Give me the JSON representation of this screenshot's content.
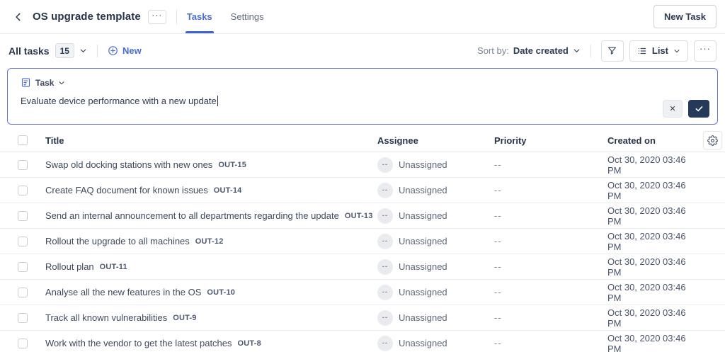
{
  "header": {
    "title": "OS upgrade template",
    "more_label": "···",
    "tabs": [
      {
        "label": "Tasks",
        "active": true
      },
      {
        "label": "Settings",
        "active": false
      }
    ],
    "new_task_button": "New Task"
  },
  "toolbar": {
    "view_label": "All tasks",
    "count_badge": "15",
    "new_label": "New",
    "sort_by_label": "Sort by:",
    "sort_value": "Date created",
    "list_button_label": "List",
    "more_label": "···"
  },
  "composer": {
    "type_label": "Task",
    "input_value": "Evaluate device performance with a new update",
    "cancel_label": "✕"
  },
  "table": {
    "columns": [
      "Title",
      "Assignee",
      "Priority",
      "Created on"
    ],
    "rows": [
      {
        "title": "Swap old docking stations with new ones",
        "id": "OUT-15",
        "avatar": "--",
        "assignee": "Unassigned",
        "priority": "--",
        "created": "Oct 30, 2020 03:46 PM"
      },
      {
        "title": "Create FAQ document for known issues",
        "id": "OUT-14",
        "avatar": "--",
        "assignee": "Unassigned",
        "priority": "--",
        "created": "Oct 30, 2020 03:46 PM"
      },
      {
        "title": "Send an internal announcement to all departments regarding the update",
        "id": "OUT-13",
        "avatar": "--",
        "assignee": "Unassigned",
        "priority": "--",
        "created": "Oct 30, 2020 03:46 PM"
      },
      {
        "title": "Rollout the upgrade to all machines",
        "id": "OUT-12",
        "avatar": "--",
        "assignee": "Unassigned",
        "priority": "--",
        "created": "Oct 30, 2020 03:46 PM"
      },
      {
        "title": "Rollout plan",
        "id": "OUT-11",
        "avatar": "--",
        "assignee": "Unassigned",
        "priority": "--",
        "created": "Oct 30, 2020 03:46 PM"
      },
      {
        "title": "Analyse all the new features in the OS",
        "id": "OUT-10",
        "avatar": "--",
        "assignee": "Unassigned",
        "priority": "--",
        "created": "Oct 30, 2020 03:46 PM"
      },
      {
        "title": "Track all known vulnerabilities",
        "id": "OUT-9",
        "avatar": "--",
        "assignee": "Unassigned",
        "priority": "--",
        "created": "Oct 30, 2020 03:46 PM"
      },
      {
        "title": "Work with the vendor to get the latest patches",
        "id": "OUT-8",
        "avatar": "--",
        "assignee": "Unassigned",
        "priority": "--",
        "created": "Oct 30, 2020 03:46 PM"
      }
    ]
  },
  "colors": {
    "accent": "#4a6bd6",
    "tab_underline": "#3f62d2",
    "confirm_button_bg": "#25395b",
    "text_dark": "#27354a",
    "text_gray": "#5f6b7e",
    "border_light": "#e8ebef",
    "composer_border": "#6679cf"
  }
}
